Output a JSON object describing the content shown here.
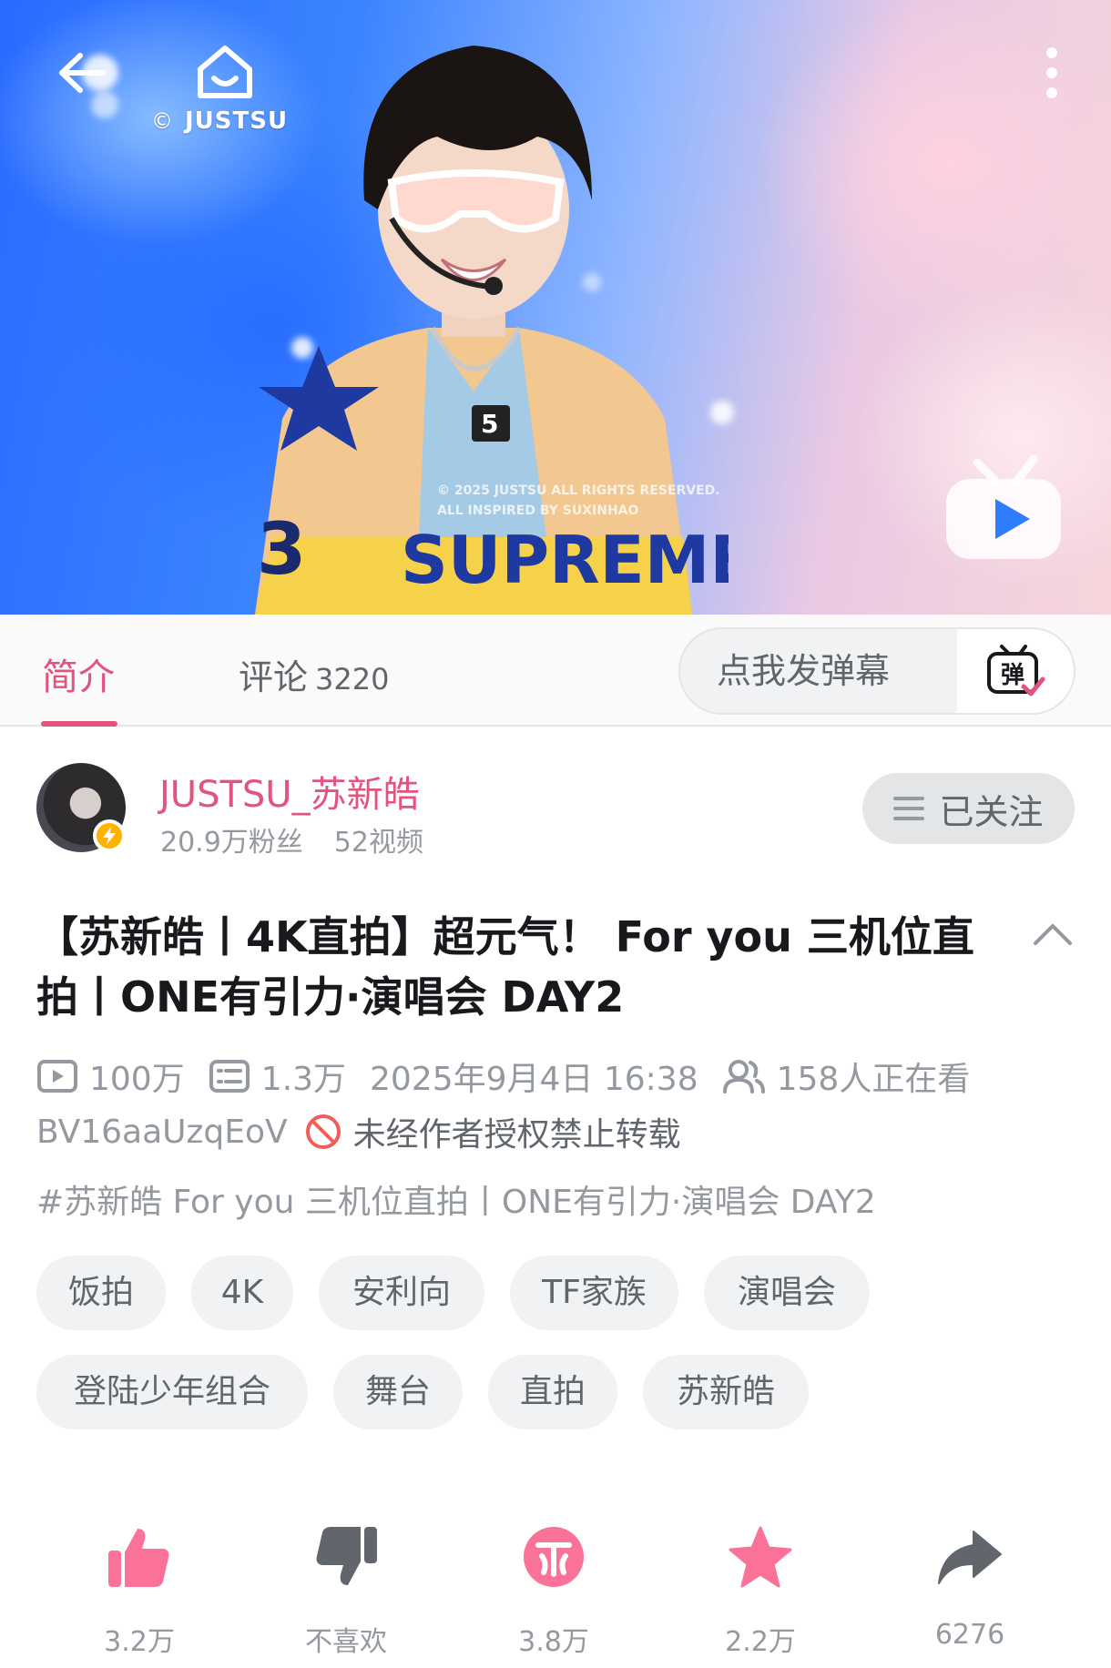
{
  "player": {
    "back_icon": "back-arrow-icon",
    "home_icon": "home-icon",
    "more_icon": "more-vertical-icon",
    "copyright_mark": "©",
    "channel_logo": "JUSTSU",
    "watermark_line1": "© 2025 JUSTSU ALL RIGHTS RESERVED.",
    "watermark_line2": "ALL INSPIRED BY SUXINHAO",
    "app_logo_icon": "bilibili-tv-icon"
  },
  "tabs": {
    "intro": "简介",
    "comments": "评论",
    "comments_count": "3220",
    "active_color": "#e2537d"
  },
  "danmaku": {
    "placeholder": "点我发弹幕",
    "toggle_icon": "danmaku-toggle-icon"
  },
  "uploader": {
    "name": "JUSTSU_苏新皓",
    "fans": "20.9万粉丝",
    "videos": "52视频",
    "follow_label": "已关注",
    "name_color": "#e2537d"
  },
  "video": {
    "title": "【苏新皓丨4K直拍】超元气！ For you 三机位直拍丨ONE有引力·演唱会 DAY2",
    "plays": "100万",
    "danmaku_count": "1.3万",
    "publish_time": "2025年9月4日 16:38",
    "watching": "158人正在看",
    "bvid": "BV16aaUzqEoV",
    "copyright_notice": "未经作者授权禁止转载",
    "topic": "#苏新皓 For you 三机位直拍丨ONE有引力·演唱会 DAY2"
  },
  "tags": [
    "饭拍",
    "4K",
    "安利向",
    "TF家族",
    "演唱会",
    "登陆少年组合",
    "舞台",
    "直拍",
    "苏新皓"
  ],
  "actions": {
    "like": "3.2万",
    "dislike": "不喜欢",
    "coin": "3.8万",
    "favorite": "2.2万",
    "share": "6276"
  }
}
